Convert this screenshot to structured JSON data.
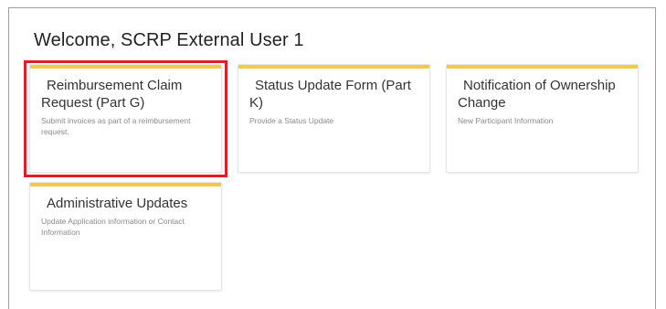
{
  "welcome": {
    "title": "Welcome, SCRP External User 1"
  },
  "cards": [
    {
      "title": "Reimbursement Claim Request (Part G)",
      "description": "Submit invoices as part of a reimbursement request."
    },
    {
      "title": "Status Update Form (Part K)",
      "description": "Provide a Status Update"
    },
    {
      "title": "Notification of Ownership Change",
      "description": "New Participant Information"
    },
    {
      "title": "Administrative Updates",
      "description": "Update Application information or Contact Information"
    }
  ],
  "colors": {
    "card_accent": "#f6c943",
    "highlight": "#e31c2a"
  }
}
